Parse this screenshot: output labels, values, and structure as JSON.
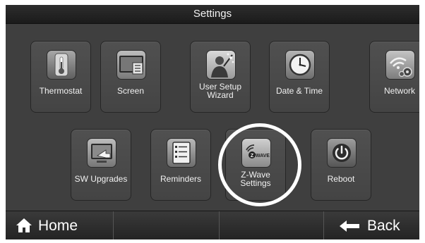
{
  "header": {
    "title": "Settings"
  },
  "tiles_row1": [
    {
      "label": "Thermostat",
      "icon": "thermostat-icon"
    },
    {
      "label": "Screen",
      "icon": "screen-icon"
    },
    {
      "label_line1": "User Setup",
      "label_line2": "Wizard",
      "icon": "wizard-icon"
    },
    {
      "label": "Date & Time",
      "icon": "clock-icon"
    },
    {
      "label": "Network",
      "icon": "network-icon"
    }
  ],
  "tiles_row2": [
    {
      "label": "SW Upgrades",
      "icon": "upgrade-icon"
    },
    {
      "label": "Reminders",
      "icon": "reminders-icon"
    },
    {
      "label_line1": "Z-Wave",
      "label_line2": "Settings",
      "icon": "zwave-icon",
      "logo_text": "WAVE",
      "highlighted": true
    },
    {
      "label": "Reboot",
      "icon": "power-icon"
    }
  ],
  "footer": {
    "home_label": "Home",
    "back_label": "Back"
  },
  "colors": {
    "background": "#3f3f3f",
    "tile": "#4a4a4a",
    "highlight_ring": "#ffffff",
    "text": "#f1f1f1"
  }
}
